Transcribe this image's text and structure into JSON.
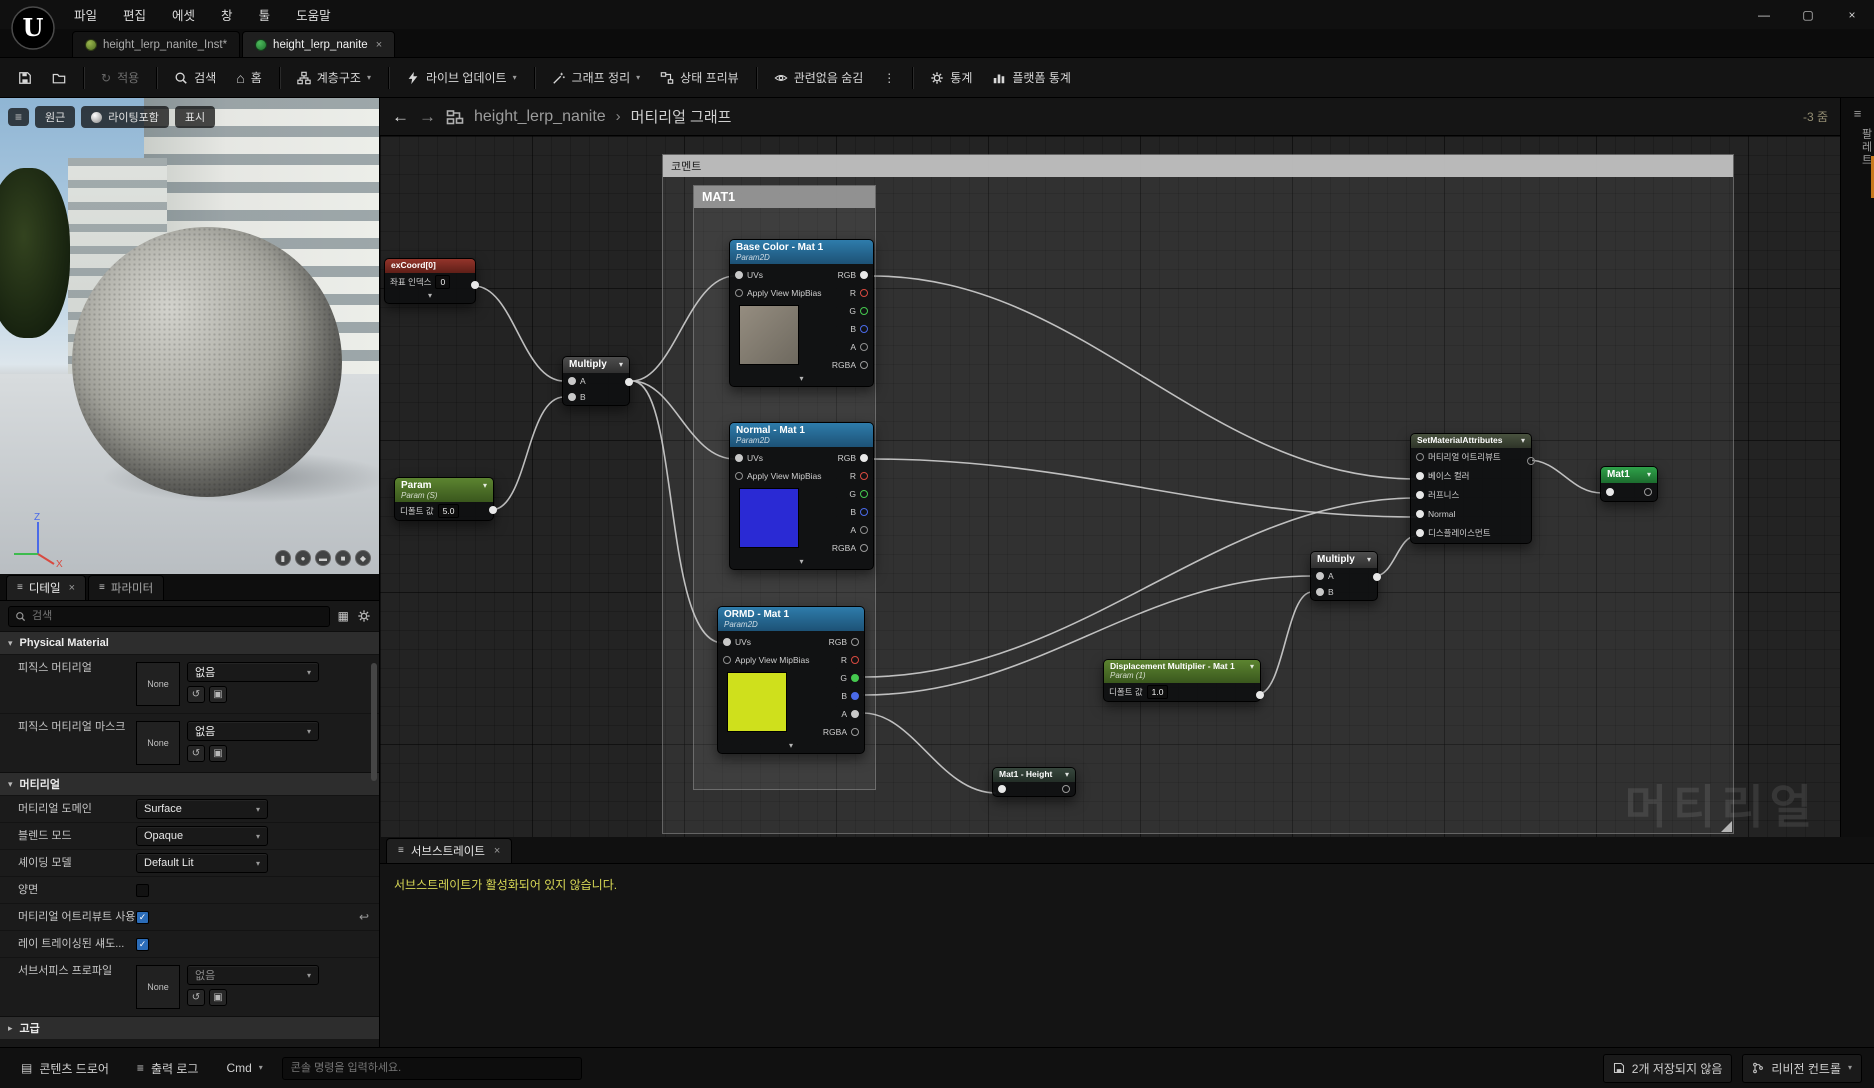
{
  "icons": {
    "chevron_down": "▾",
    "chevron_right": "▸",
    "hamburger": "≡",
    "more": "⋮",
    "back": "←",
    "forward": "→",
    "close": "×",
    "check": "✓",
    "use_arrow": "↺",
    "revert": "↩",
    "home": "⌂",
    "apply": "↻",
    "browse": "▣",
    "drawer": "▤",
    "grid": "▦",
    "minimize": "—",
    "maximize": "▢",
    "breadcrumb_sep": "›"
  },
  "menu": {
    "items": [
      "파일",
      "편집",
      "에셋",
      "창",
      "툴",
      "도움말"
    ]
  },
  "asset_tabs": [
    {
      "label": "height_lerp_nanite_Inst*"
    },
    {
      "label": "height_lerp_nanite"
    }
  ],
  "toolbar": {
    "apply": "적용",
    "search": "검색",
    "home": "홈",
    "hierarchy": "계층구조",
    "live_update": "라이브 업데이트",
    "clean_graph": "그래프 정리",
    "preview_state": "상태 프리뷰",
    "hide_unrelated": "관련없음 숨김",
    "stats": "통계",
    "platform_stats": "플랫폼 통계"
  },
  "viewport": {
    "perspective": "원근",
    "lit": "라이팅포함",
    "show": "표시",
    "axis_x": "X",
    "axis_z": "Z"
  },
  "detail_tabs": {
    "details": "디테일",
    "parameters": "파라미터"
  },
  "details": {
    "search_placeholder": "검색",
    "section_physical": "Physical Material",
    "physical": [
      {
        "label": "피직스 머티리얼",
        "asset": "None",
        "dropdown": "없음"
      },
      {
        "label": "피직스 머티리얼 마스크",
        "asset": "None",
        "dropdown": "없음"
      }
    ],
    "section_material": "머티리얼",
    "domain_label": "머티리얼 도메인",
    "domain_value": "Surface",
    "blend_label": "블렌드 모드",
    "blend_value": "Opaque",
    "shading_label": "셰이딩 모델",
    "shading_value": "Default Lit",
    "two_sided_label": "양면",
    "use_attributes_label": "머티리얼 어트리뷰트 사용",
    "ray_traced_label": "레이 트레이싱된 섀도...",
    "subsurface_label": "서브서피스 프로파일",
    "subsurface_asset": "None",
    "subsurface_dropdown": "없음",
    "section_advanced": "고급"
  },
  "graph": {
    "breadcrumb_title": "height_lerp_nanite",
    "breadcrumb_sub": "머티리얼 그래프",
    "zoom": "-3 줌",
    "watermark": "머티리얼",
    "comment_outer": "코멘트",
    "comment_inner": "MAT1",
    "nodes": {
      "texcoord": {
        "title": "exCoord[0]",
        "index_label": "좌표 인덱스",
        "index_value": "0"
      },
      "multiply1": {
        "title": "Multiply",
        "a": "A",
        "b": "B"
      },
      "param": {
        "title": "Param",
        "subtitle": "Param (S)",
        "default_label": "디폴트 값",
        "default_value": "5.0"
      },
      "base_color": {
        "title": "Base Color - Mat 1",
        "subtitle": "Param2D",
        "uvs": "UVs",
        "mip": "Apply View MipBias",
        "outputs": [
          "RGB",
          "R",
          "G",
          "B",
          "A",
          "RGBA"
        ]
      },
      "normal": {
        "title": "Normal - Mat 1",
        "subtitle": "Param2D",
        "uvs": "UVs",
        "mip": "Apply View MipBias",
        "outputs": [
          "RGB",
          "R",
          "G",
          "B",
          "A",
          "RGBA"
        ]
      },
      "ormd": {
        "title": "ORMD - Mat 1",
        "subtitle": "Param2D",
        "uvs": "UVs",
        "mip": "Apply View MipBias",
        "outputs": [
          "RGB",
          "R",
          "G",
          "B",
          "A",
          "RGBA"
        ]
      },
      "sma": {
        "title": "SetMaterialAttributes",
        "pins": [
          "머티리얼 어트리뷰트",
          "베이스 컬러",
          "러프니스",
          "Normal",
          "디스플레이스먼트"
        ]
      },
      "result": {
        "title": "Mat1"
      },
      "multiply2": {
        "title": "Multiply",
        "a": "A",
        "b": "B"
      },
      "disp": {
        "title": "Displacement Multiplier - Mat 1",
        "subtitle": "Param (1)",
        "default_label": "디폴트 값",
        "default_value": "1.0"
      },
      "height": {
        "title": "Mat1 - Height"
      }
    }
  },
  "right_strip": {
    "label": "팔레트"
  },
  "substrate": {
    "tab": "서브스트레이트",
    "message": "서브스트레이트가 활성화되어 있지 않습니다."
  },
  "statusbar": {
    "content_drawer": "콘텐츠 드로어",
    "output_log": "출력 로그",
    "cmd": "Cmd",
    "console_placeholder": "콘솔 명령을 입력하세요.",
    "unsaved": "2개 저장되지 않음",
    "revision": "리비전 컨트롤"
  }
}
